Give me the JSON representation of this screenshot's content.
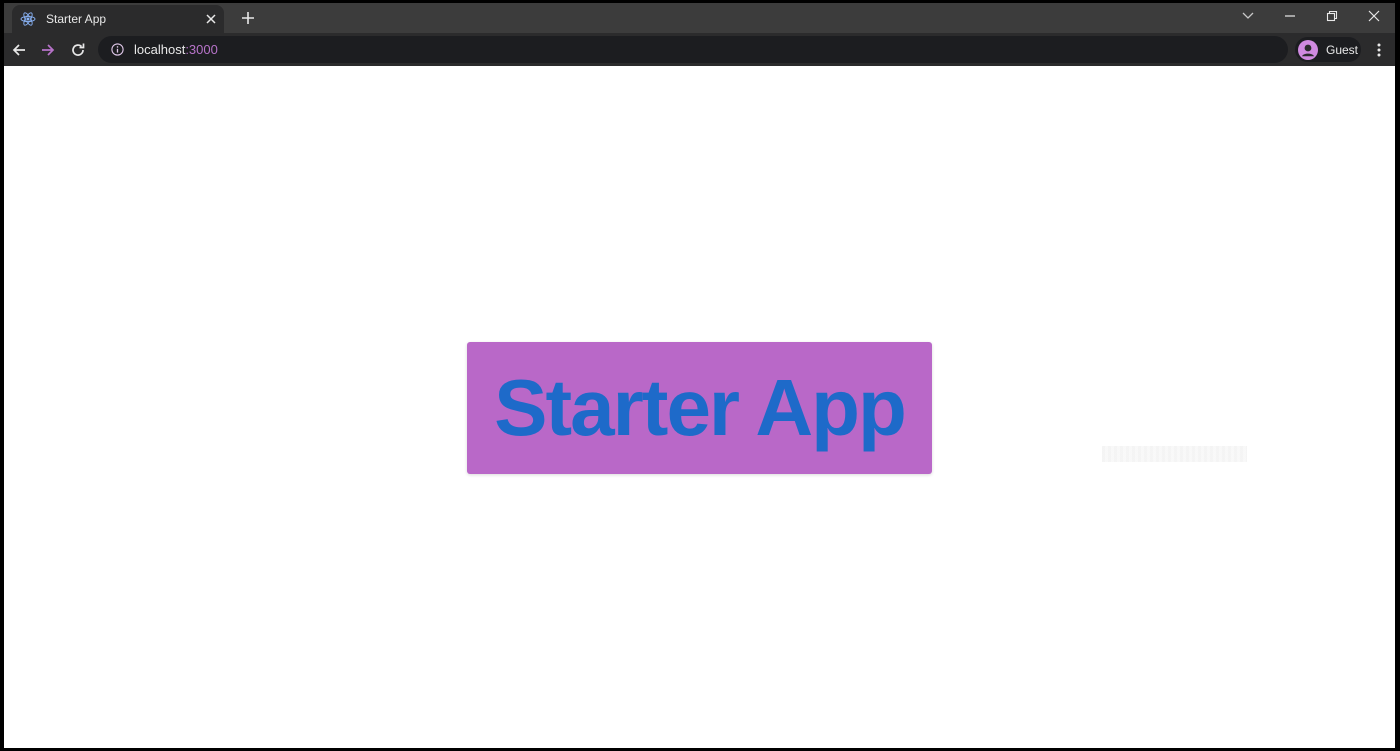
{
  "browser": {
    "tab": {
      "title": "Starter App"
    },
    "address": {
      "host": "localhost",
      "port": ":3000"
    },
    "profile": {
      "label": "Guest"
    }
  },
  "page": {
    "heading": "Starter App"
  },
  "colors": {
    "hero_background": "#b968c8",
    "hero_text": "#1e6ac9",
    "chrome_dark": "#2b2b2c",
    "accent": "#b773c9"
  }
}
